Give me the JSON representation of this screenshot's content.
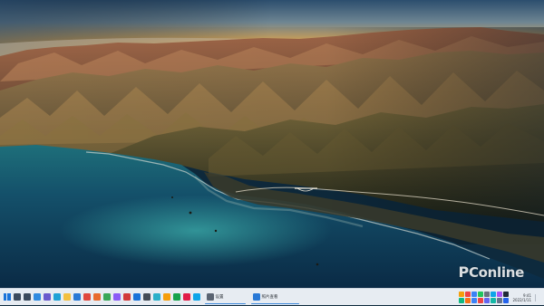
{
  "watermark": {
    "prefix": "P",
    "text": "Conline"
  },
  "taskbar": {
    "pinned": [
      {
        "name": "start-icon",
        "color": "#1a73d9"
      },
      {
        "name": "search-icon",
        "color": "#3b4a5c"
      },
      {
        "name": "task-view-icon",
        "color": "#3b4a5c"
      },
      {
        "name": "widgets-icon",
        "color": "#2f8be0"
      },
      {
        "name": "chat-icon",
        "color": "#6a5acd"
      },
      {
        "name": "edge-icon",
        "color": "#1fa2d6"
      },
      {
        "name": "explorer-icon",
        "color": "#f3c040"
      },
      {
        "name": "store-icon",
        "color": "#2979d6"
      },
      {
        "name": "mail-icon",
        "color": "#e0483e"
      },
      {
        "name": "app-icon-1",
        "color": "#e86a2e"
      },
      {
        "name": "app-icon-2",
        "color": "#3aa757"
      },
      {
        "name": "app-icon-3",
        "color": "#8b5cf6"
      },
      {
        "name": "app-icon-4",
        "color": "#d23b3b"
      },
      {
        "name": "app-icon-5",
        "color": "#1a73d9"
      },
      {
        "name": "app-icon-6",
        "color": "#444c56"
      },
      {
        "name": "app-icon-7",
        "color": "#2bb0c9"
      },
      {
        "name": "app-icon-8",
        "color": "#f59e0b"
      },
      {
        "name": "app-icon-9",
        "color": "#16a34a"
      },
      {
        "name": "app-icon-10",
        "color": "#e11d48"
      },
      {
        "name": "app-icon-11",
        "color": "#0ea5e9"
      }
    ],
    "running_apps": [
      {
        "label": "设置",
        "icon_color": "#5a6472"
      },
      {
        "label": "照片查看",
        "icon_color": "#2979d6"
      }
    ],
    "tray_colors": [
      "#f59e0b",
      "#ef4444",
      "#3b82f6",
      "#22c55e",
      "#6b7280",
      "#0ea5e9",
      "#a855f7",
      "#1f2937",
      "#10b981",
      "#f97316",
      "#3b82f6",
      "#ef4444",
      "#6366f1",
      "#14b8a6",
      "#64748b",
      "#2563eb"
    ],
    "clock": {
      "time": "9:41",
      "date": "2022/1/11"
    }
  }
}
